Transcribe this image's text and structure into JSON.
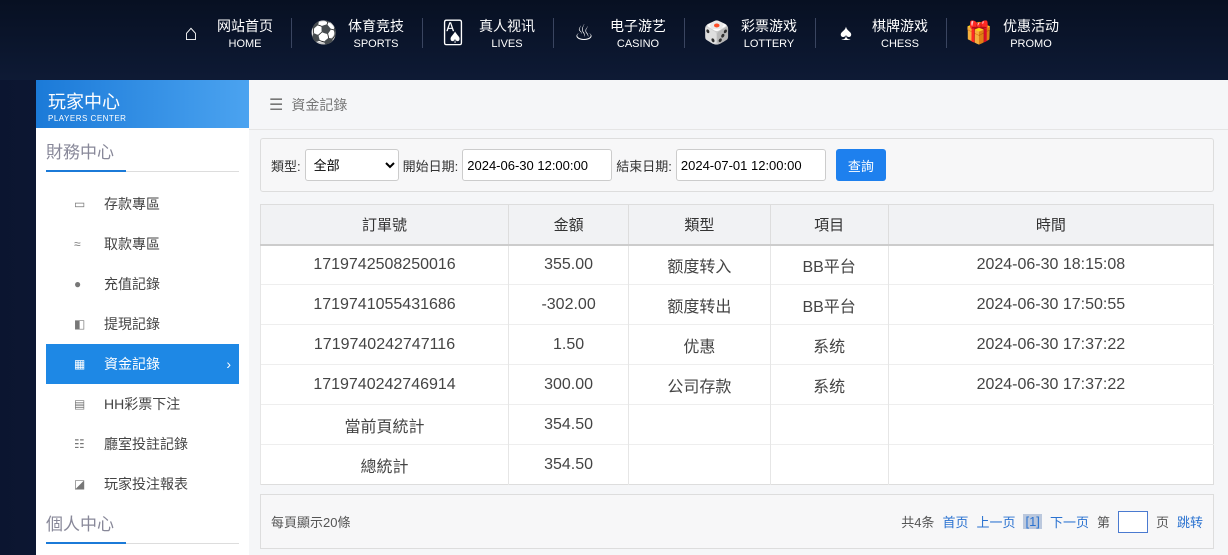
{
  "nav": [
    {
      "cn": "网站首页",
      "en": "HOME",
      "icon": "⌂"
    },
    {
      "cn": "体育竞技",
      "en": "SPORTS",
      "icon": "⚽"
    },
    {
      "cn": "真人视讯",
      "en": "LIVES",
      "icon": "🂡"
    },
    {
      "cn": "电子游艺",
      "en": "CASINO",
      "icon": "♨"
    },
    {
      "cn": "彩票游戏",
      "en": "LOTTERY",
      "icon": "🎲"
    },
    {
      "cn": "棋牌游戏",
      "en": "CHESS",
      "icon": "♠"
    },
    {
      "cn": "优惠活动",
      "en": "PROMO",
      "icon": "🎁"
    }
  ],
  "sidebar": {
    "title": "玩家中心",
    "subtitle": "PLAYERS CENTER",
    "section1": "財務中心",
    "section2": "個人中心",
    "items": [
      {
        "label": "存款專區",
        "icon": "▭"
      },
      {
        "label": "取款專區",
        "icon": "≈"
      },
      {
        "label": "充值記錄",
        "icon": "●"
      },
      {
        "label": "提現記錄",
        "icon": "◧"
      },
      {
        "label": "資金記錄",
        "icon": "▦",
        "active": true
      },
      {
        "label": "HH彩票下注",
        "icon": "▤"
      },
      {
        "label": "廳室投註記錄",
        "icon": "☷"
      },
      {
        "label": "玩家投注報表",
        "icon": "◪"
      }
    ]
  },
  "breadcrumb": "資金記錄",
  "filter": {
    "type_label": "類型:",
    "type_value": "全部",
    "start_label": "開始日期:",
    "start_value": "2024-06-30 12:00:00",
    "end_label": "結束日期:",
    "end_value": "2024-07-01 12:00:00",
    "search": "查詢"
  },
  "table": {
    "headers": [
      "訂單號",
      "金額",
      "類型",
      "項目",
      "時間"
    ],
    "rows": [
      [
        "1719742508250016",
        "355.00",
        "额度转入",
        "BB平台",
        "2024-06-30 18:15:08"
      ],
      [
        "1719741055431686",
        "-302.00",
        "额度转出",
        "BB平台",
        "2024-06-30 17:50:55"
      ],
      [
        "1719740242747116",
        "1.50",
        "优惠",
        "系统",
        "2024-06-30 17:37:22"
      ],
      [
        "1719740242746914",
        "300.00",
        "公司存款",
        "系统",
        "2024-06-30 17:37:22"
      ]
    ],
    "page_total_label": "當前頁統計",
    "page_total": "354.50",
    "total_label": "總統計",
    "total": "354.50"
  },
  "pager": {
    "per_page": "每頁顯示20條",
    "count": "共4条",
    "first": "首页",
    "prev": "上一页",
    "current": "[1]",
    "next": "下一页",
    "di": "第",
    "ye": "页",
    "jump": "跳转"
  }
}
